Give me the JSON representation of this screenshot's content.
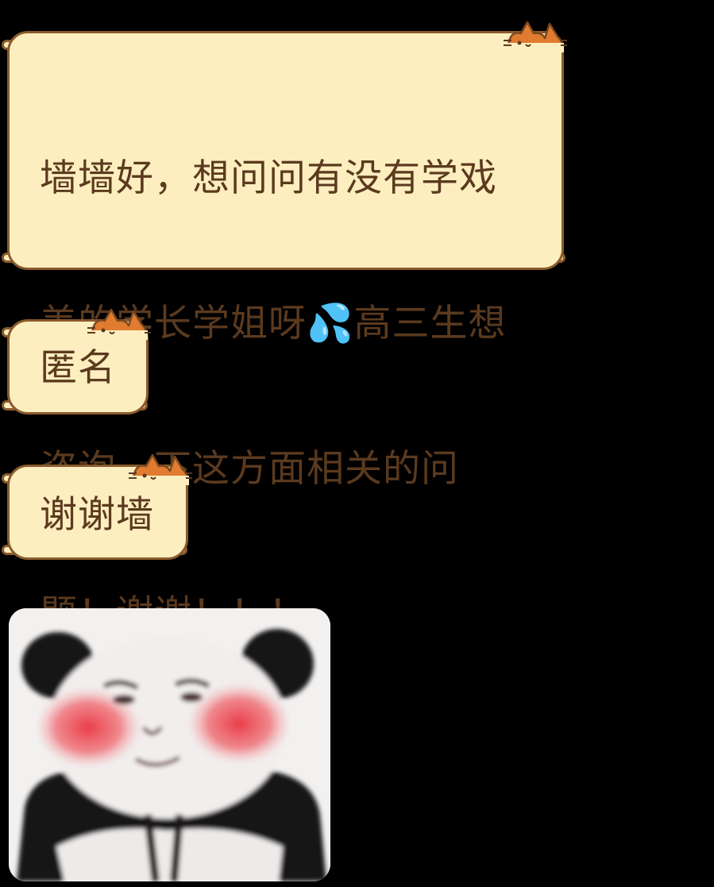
{
  "messages": [
    {
      "type": "text",
      "lines": [
        "墙墙好，想问问有没有学戏",
        "美的学长学姐呀💦高三生想",
        "咨询一下这方面相关的问",
        "题！谢谢！！！"
      ]
    },
    {
      "type": "text",
      "text": "匿名"
    },
    {
      "type": "text",
      "text": "谢谢墙"
    },
    {
      "type": "sticker",
      "sticker_name": "blushing-panda-sticker"
    }
  ],
  "theme": {
    "bubble_fill": "#fdeec0",
    "bubble_border": "#8a5a2b",
    "text_color": "#5b3a1e",
    "cat_ear_color": "#e07b2f",
    "background": "#000000"
  }
}
